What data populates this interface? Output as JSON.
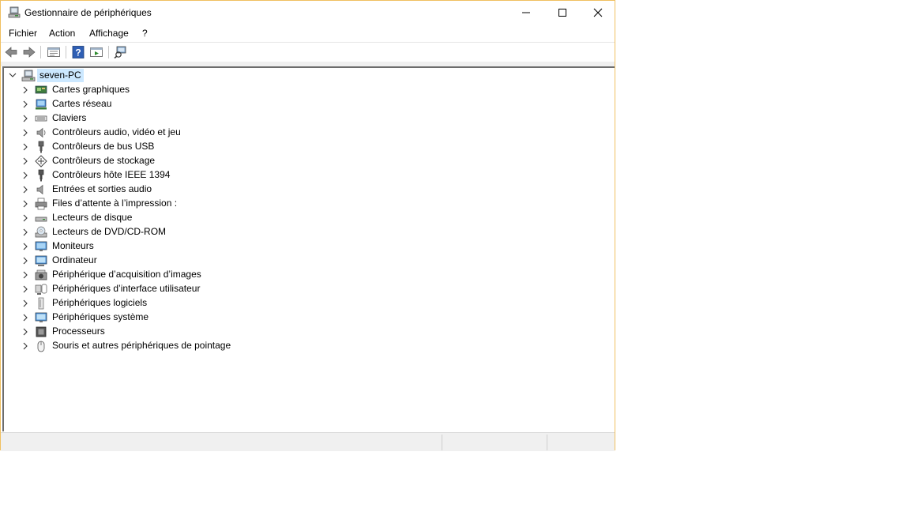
{
  "window": {
    "title": "Gestionnaire de périphériques"
  },
  "menu": [
    "Fichier",
    "Action",
    "Affichage",
    "?"
  ],
  "toolbar": [
    "back-icon",
    "forward-icon",
    "properties-view-icon",
    "help-icon",
    "action-view-icon",
    "scan-hardware-icon"
  ],
  "tree": {
    "root": "seven-PC",
    "categories": [
      {
        "label": "Cartes graphiques",
        "icon": "display-adapter-icon"
      },
      {
        "label": "Cartes réseau",
        "icon": "network-adapter-icon"
      },
      {
        "label": "Claviers",
        "icon": "keyboard-icon"
      },
      {
        "label": "Contrôleurs audio, vidéo et jeu",
        "icon": "speaker-icon"
      },
      {
        "label": "Contrôleurs de bus USB",
        "icon": "usb-icon"
      },
      {
        "label": "Contrôleurs de stockage",
        "icon": "storage-controller-icon"
      },
      {
        "label": "Contrôleurs hôte IEEE 1394",
        "icon": "firewire-icon"
      },
      {
        "label": "Entrées et sorties audio",
        "icon": "audio-io-icon"
      },
      {
        "label": "Files d’attente à l’impression :",
        "icon": "printer-icon"
      },
      {
        "label": "Lecteurs de disque",
        "icon": "disk-drive-icon"
      },
      {
        "label": "Lecteurs de DVD/CD-ROM",
        "icon": "dvd-icon"
      },
      {
        "label": "Moniteurs",
        "icon": "monitor-icon"
      },
      {
        "label": "Ordinateur",
        "icon": "computer-icon"
      },
      {
        "label": "Périphérique d’acquisition d’images",
        "icon": "camera-icon"
      },
      {
        "label": "Périphériques d’interface utilisateur",
        "icon": "hid-icon"
      },
      {
        "label": "Périphériques logiciels",
        "icon": "software-device-icon"
      },
      {
        "label": "Périphériques système",
        "icon": "system-device-icon"
      },
      {
        "label": "Processeurs",
        "icon": "processor-icon"
      },
      {
        "label": "Souris et autres périphériques de pointage",
        "icon": "mouse-icon"
      }
    ]
  }
}
